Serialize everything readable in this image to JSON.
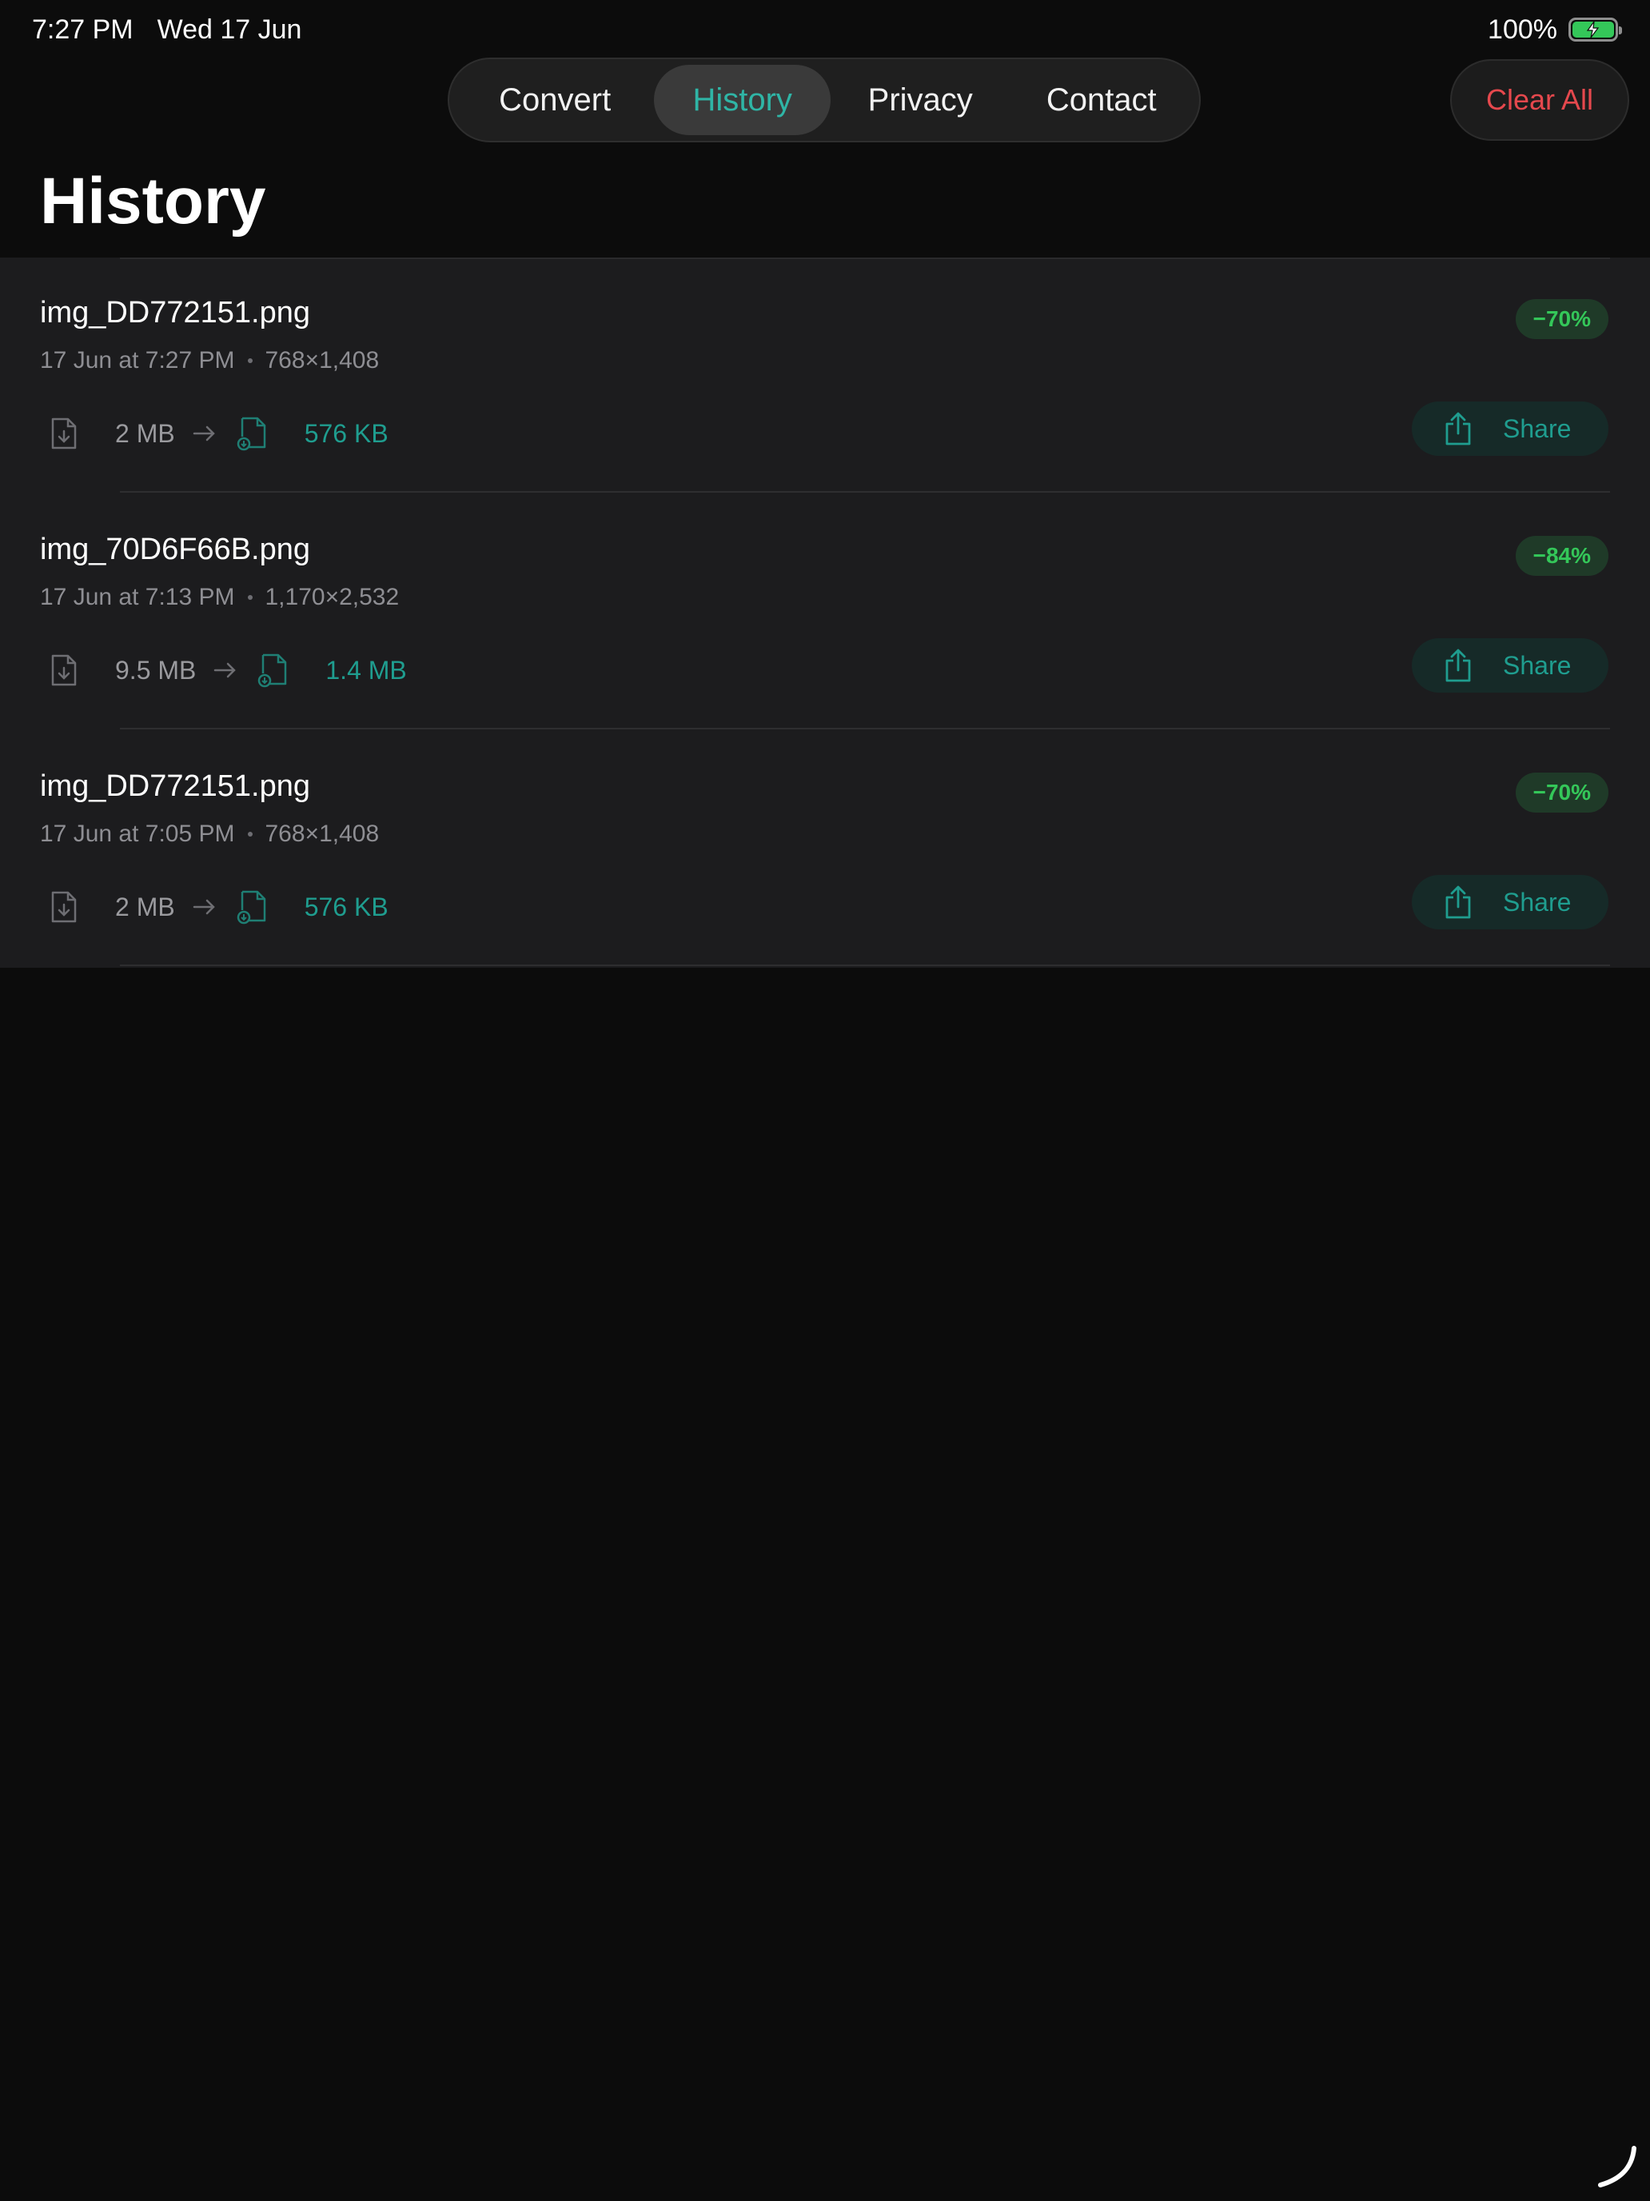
{
  "status_bar": {
    "time": "7:27 PM",
    "date": "Wed 17 Jun",
    "battery_percent": "100%",
    "battery_level": 1.0,
    "charging": true
  },
  "nav": {
    "tabs": [
      {
        "label": "Convert",
        "selected": false
      },
      {
        "label": "History",
        "selected": true
      },
      {
        "label": "Privacy",
        "selected": false
      },
      {
        "label": "Contact",
        "selected": false
      }
    ]
  },
  "toolbar": {
    "clear_all_label": "Clear All"
  },
  "page": {
    "title": "History"
  },
  "history": [
    {
      "filename": "img_DD772151.png",
      "timestamp": "17 Jun at 7:27 PM",
      "dimensions": "768×1,408",
      "reduction": "−70%",
      "original_size": "2 MB",
      "new_size": "576 KB",
      "share_label": "Share"
    },
    {
      "filename": "img_70D6F66B.png",
      "timestamp": "17 Jun at 7:13 PM",
      "dimensions": "1,170×2,532",
      "reduction": "−84%",
      "original_size": "9.5 MB",
      "new_size": "1.4 MB",
      "share_label": "Share"
    },
    {
      "filename": "img_DD772151.png",
      "timestamp": "17 Jun at 7:05 PM",
      "dimensions": "768×1,408",
      "reduction": "−70%",
      "original_size": "2 MB",
      "new_size": "576 KB",
      "share_label": "Share"
    }
  ],
  "colors": {
    "accent": "#2fb5a6",
    "destructive": "#e5484d",
    "badge_text": "#34c759",
    "background": "#0c0c0c",
    "row_background": "#1c1c1e"
  },
  "icons": {
    "file_original": "file-download-icon",
    "file_converted": "file-converted-icon",
    "arrow": "arrow-right-icon",
    "share": "share-icon",
    "battery": "battery-charging-icon"
  }
}
